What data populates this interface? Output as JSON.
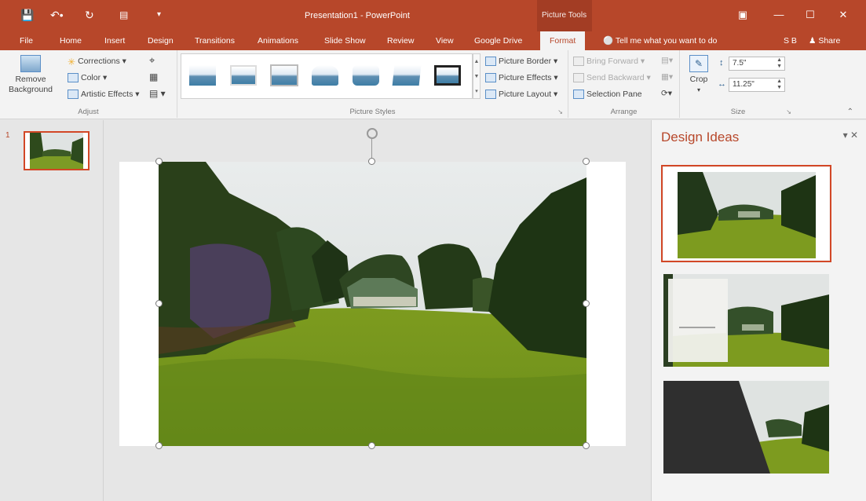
{
  "titlebar": {
    "title": "Presentation1 - PowerPoint",
    "context_tab_group": "Picture Tools",
    "user_initials": "S B",
    "share_label": "Share",
    "accent_color": "#b7472a"
  },
  "tabs": [
    {
      "label": "File"
    },
    {
      "label": "Home"
    },
    {
      "label": "Insert"
    },
    {
      "label": "Design"
    },
    {
      "label": "Transitions"
    },
    {
      "label": "Animations"
    },
    {
      "label": "Slide Show"
    },
    {
      "label": "Review"
    },
    {
      "label": "View"
    },
    {
      "label": "Google Drive"
    },
    {
      "label": "Format",
      "active": true
    }
  ],
  "tell_me": "Tell me what you want to do",
  "ribbon": {
    "adjust": {
      "remove_background": "Remove Background",
      "remove_line1": "Remove",
      "remove_line2": "Background",
      "corrections": "Corrections",
      "color": "Color",
      "artistic_effects": "Artistic Effects",
      "group_label": "Adjust"
    },
    "picture_styles": {
      "picture_border": "Picture Border",
      "picture_effects": "Picture Effects",
      "picture_layout": "Picture Layout",
      "group_label": "Picture Styles"
    },
    "arrange": {
      "bring_forward": "Bring Forward",
      "send_backward": "Send Backward",
      "selection_pane": "Selection Pane",
      "group_label": "Arrange"
    },
    "size": {
      "crop": "Crop",
      "height": "7.5\"",
      "width": "11.25\"",
      "group_label": "Size"
    }
  },
  "slides_pane": {
    "slide_number": "1"
  },
  "design_ideas": {
    "title": "Design Ideas"
  }
}
